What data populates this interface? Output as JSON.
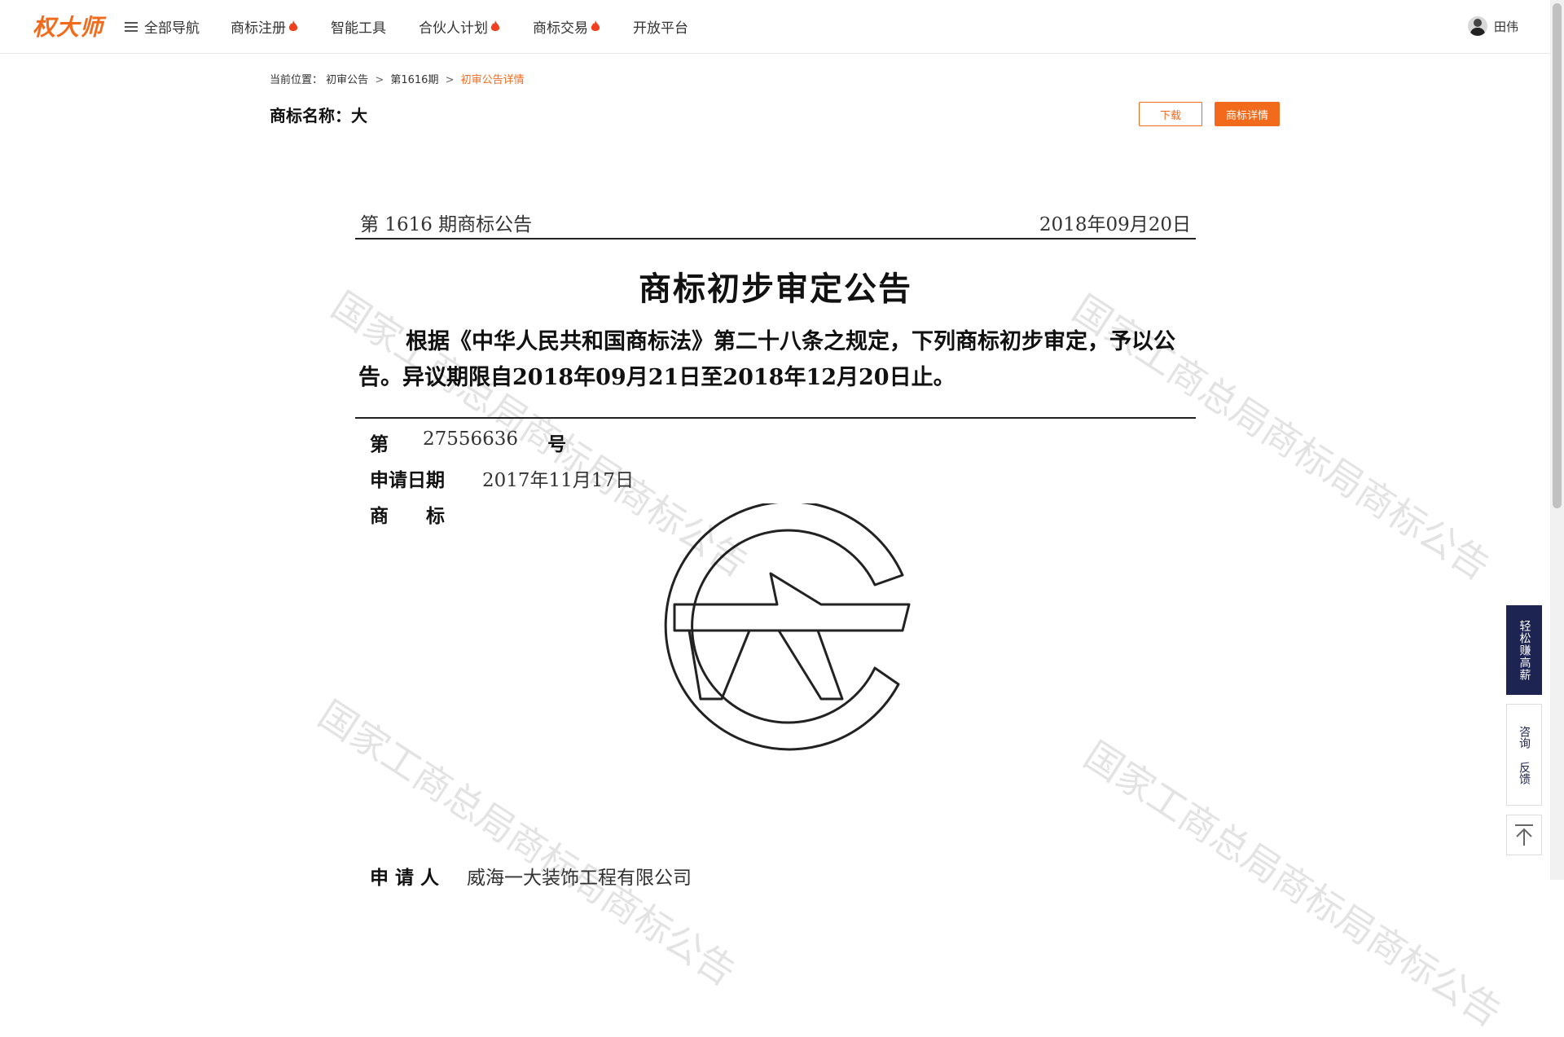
{
  "header": {
    "logo_text": "权大师",
    "nav": [
      {
        "label": "全部导航",
        "hot": false
      },
      {
        "label": "商标注册",
        "hot": true
      },
      {
        "label": "智能工具",
        "hot": false
      },
      {
        "label": "合伙人计划",
        "hot": true
      },
      {
        "label": "商标交易",
        "hot": true
      },
      {
        "label": "开放平台",
        "hot": false
      }
    ],
    "user_name": "田伟"
  },
  "breadcrumb": {
    "prefix": "当前位置：",
    "items": [
      "初审公告",
      "第1616期"
    ],
    "current": "初审公告详情",
    "separator": ">"
  },
  "trademark_title": "商标名称：大",
  "actions": {
    "download": "下载",
    "detail": "商标详情"
  },
  "document": {
    "issue": "第 1616 期商标公告",
    "date": "2018年09月20日",
    "heading": "商标初步审定公告",
    "paragraph": "根据《中华人民共和国商标法》第二十八条之规定，下列商标初步审定，予以公告。异议期限自2018年09月21日至2018年12月20日止。",
    "fields": {
      "number_label_start": "第",
      "number_value": "27556636",
      "number_label_end": "号",
      "apply_date_label": "申请日期",
      "apply_date_value": "2017年11月17日",
      "mark_label": "商　　标",
      "applicant_label": "申 请 人",
      "applicant_value": "威海一大装饰工程有限公司"
    },
    "watermark_text": "国家工商总局商标局商标公告"
  },
  "float_tools": {
    "earn": "轻松赚高薪",
    "consult": "咨询",
    "feedback": "反馈"
  },
  "colors": {
    "accent": "#f26b1d",
    "navy": "#1d2452"
  }
}
